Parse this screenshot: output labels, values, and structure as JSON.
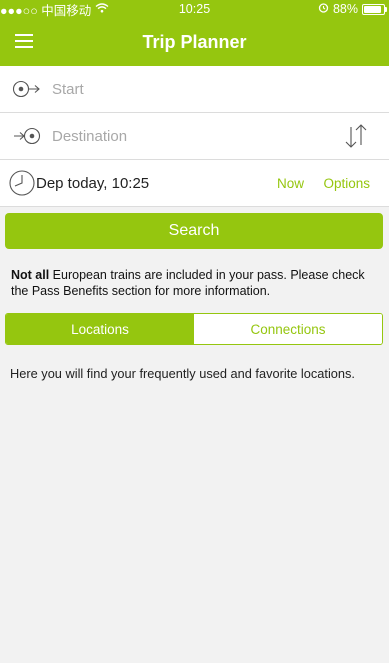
{
  "statusbar": {
    "carrier": "●●●○○ 中国移动",
    "time": "10:25",
    "battery": "88%"
  },
  "nav": {
    "title": "Trip Planner"
  },
  "form": {
    "start_placeholder": "Start",
    "destination_placeholder": "Destination",
    "departure_text": "Dep today, 10:25",
    "now_label": "Now",
    "options_label": "Options"
  },
  "search_label": "Search",
  "notice": {
    "bold": "Not all",
    "rest": " European trains are included in your pass. Please check the Pass Benefits section for more information."
  },
  "tabs": {
    "locations": "Locations",
    "connections": "Connections"
  },
  "info_text": "Here you will find your frequently used and favorite locations.",
  "colors": {
    "accent": "#95c60f",
    "background": "#f2f2f2"
  }
}
